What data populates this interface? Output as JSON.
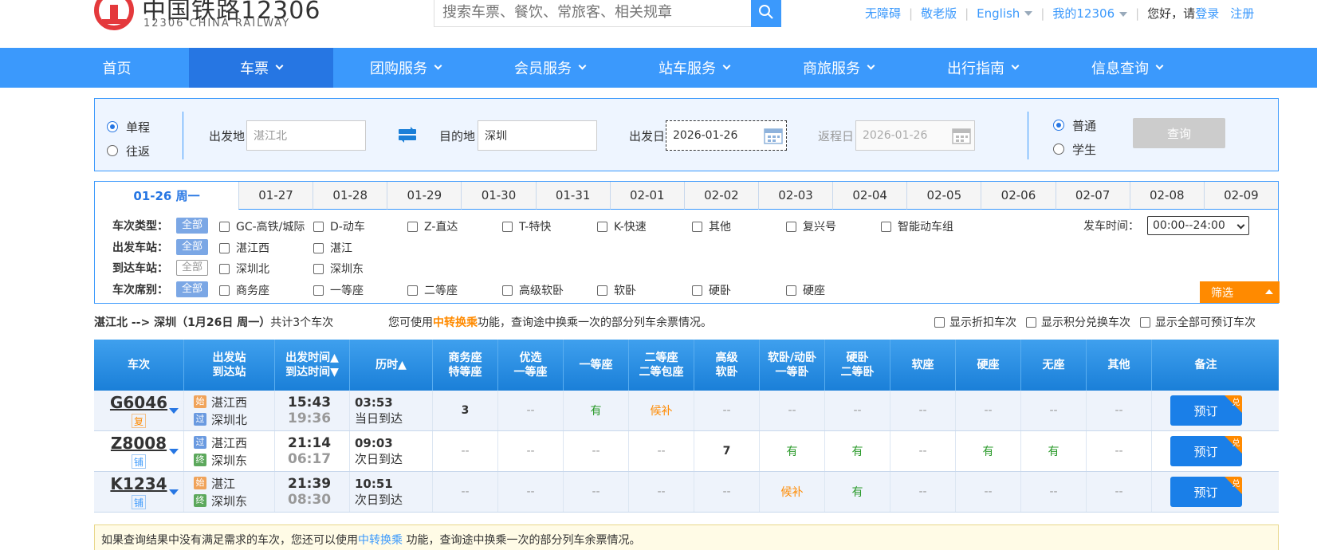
{
  "header": {
    "brand_title": "中国铁路12306",
    "brand_sub": "12306 CHINA RAILWAY",
    "search_placeholder": "搜索车票、餐饮、常旅客、相关规章",
    "links": {
      "accessible": "无障碍",
      "elderly": "敬老版",
      "english": "English",
      "my12306": "我的12306",
      "greeting": "您好，请",
      "login": "登录",
      "register": "注册"
    }
  },
  "nav": {
    "items": [
      {
        "label": "首页"
      },
      {
        "label": "车票"
      },
      {
        "label": "团购服务"
      },
      {
        "label": "会员服务"
      },
      {
        "label": "站车服务"
      },
      {
        "label": "商旅服务"
      },
      {
        "label": "出行指南"
      },
      {
        "label": "信息查询"
      }
    ]
  },
  "query": {
    "one_way": "单程",
    "round_trip": "往返",
    "from_label": "出发地",
    "from_value": "湛江北",
    "to_label": "目的地",
    "to_value": "深圳",
    "depart_label": "出发日",
    "depart_value": "2026-01-26",
    "return_label": "返程日",
    "return_value": "2026-01-26",
    "normal": "普通",
    "student": "学生",
    "query_btn": "查询"
  },
  "date_tabs": [
    "01-26 周一",
    "01-27",
    "01-28",
    "01-29",
    "01-30",
    "01-31",
    "02-01",
    "02-02",
    "02-03",
    "02-04",
    "02-05",
    "02-06",
    "02-07",
    "02-08",
    "02-09"
  ],
  "filters": {
    "all": "全部",
    "train_type_label": "车次类型：",
    "train_types": [
      "GC-高铁/城际",
      "D-动车",
      "Z-直达",
      "T-特快",
      "K-快速",
      "其他",
      "复兴号",
      "智能动车组"
    ],
    "depart_station_label": "出发车站：",
    "depart_stations": [
      "湛江西",
      "湛江"
    ],
    "arrive_station_label": "到达车站：",
    "arrive_stations": [
      "深圳北",
      "深圳东"
    ],
    "seat_label": "车次席别：",
    "seats": [
      "商务座",
      "一等座",
      "二等座",
      "高级软卧",
      "软卧",
      "硬卧",
      "硬座"
    ],
    "time_label": "发车时间：",
    "time_value": "00:00--24:00",
    "filter_btn": "筛选"
  },
  "summary": {
    "route": "湛江北 --> 深圳（1月26日  周一）",
    "count": "共计3个车次",
    "hint_pre": "您可使用",
    "hint_link": "中转换乘",
    "hint_post": "功能，查询途中换乘一次的部分列车余票情况。",
    "opt1": "显示折扣车次",
    "opt2": "显示积分兑换车次",
    "opt3": "显示全部可预订车次"
  },
  "table": {
    "headers": [
      [
        "车次"
      ],
      [
        "出发站",
        "到达站"
      ],
      [
        "出发时间▲",
        "到达时间▼"
      ],
      [
        "历时▲"
      ],
      [
        "商务座",
        "特等座"
      ],
      [
        "优选",
        "一等座"
      ],
      [
        "一等座"
      ],
      [
        "二等座",
        "二等包座"
      ],
      [
        "高级",
        "软卧"
      ],
      [
        "软卧/动卧",
        "一等卧"
      ],
      [
        "硬卧",
        "二等卧"
      ],
      [
        "软座"
      ],
      [
        "硬座"
      ],
      [
        "无座"
      ],
      [
        "其他"
      ],
      [
        "备注"
      ]
    ],
    "rows": [
      {
        "train": "G6046",
        "tag": "复",
        "from_badge": "始",
        "from": "湛江西",
        "to_badge": "过",
        "to": "深圳北",
        "dep": "15:43",
        "arr": "19:36",
        "dur": "03:53",
        "day": "当日到达",
        "seats": [
          "3",
          "--",
          "有",
          "候补",
          "--",
          "--",
          "--",
          "--",
          "--",
          "--",
          "--"
        ],
        "book": "预订",
        "corner": "兑"
      },
      {
        "train": "Z8008",
        "tag": "铺",
        "from_badge": "过",
        "from": "湛江西",
        "to_badge": "终",
        "to": "深圳东",
        "dep": "21:14",
        "arr": "06:17",
        "dur": "09:03",
        "day": "次日到达",
        "seats": [
          "--",
          "--",
          "--",
          "--",
          "7",
          "有",
          "有",
          "--",
          "有",
          "有",
          "--"
        ],
        "book": "预订",
        "corner": "兑"
      },
      {
        "train": "K1234",
        "tag": "铺",
        "from_badge": "始",
        "from": "湛江",
        "to_badge": "终",
        "to": "深圳东",
        "dep": "21:39",
        "arr": "08:30",
        "dur": "10:51",
        "day": "次日到达",
        "seats": [
          "--",
          "--",
          "--",
          "--",
          "--",
          "候补",
          "有",
          "--",
          "--",
          "--",
          "--"
        ],
        "book": "预订",
        "corner": "兑"
      }
    ]
  },
  "note": {
    "pre": "如果查询结果中没有满足需求的车次，您还可以使用",
    "link": "中转换乘",
    "post": " 功能，查询途中换乘一次的部分列车余票情况。"
  },
  "colors": {
    "primary": "#3b99fc",
    "nav_active": "#2676e3",
    "accent": "#ff8a00",
    "available": "#2a9a2a"
  }
}
